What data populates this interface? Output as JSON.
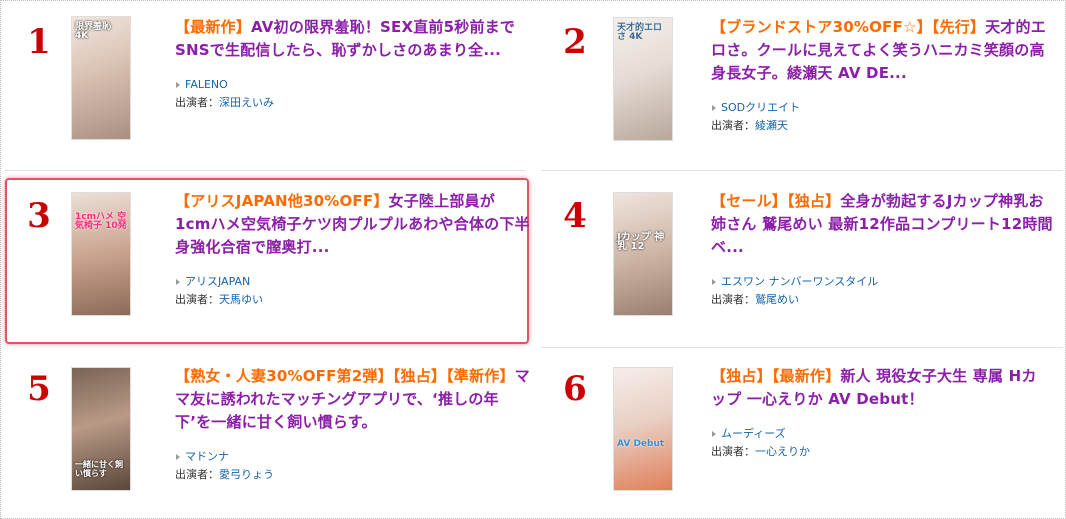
{
  "items": [
    {
      "rank": "1",
      "tags": [
        "【最新作】"
      ],
      "title": "AV初の限界羞恥！SEX直前5秒前までSNSで生配信したら、恥ずかしさのあまり全...",
      "maker": "FALENO",
      "actor_label": "出演者：",
      "actor": "深田えいみ",
      "thumb": {
        "caption": "限界羞恥 4K",
        "color": "#d9c1b2"
      }
    },
    {
      "rank": "2",
      "tags": [
        "【ブランドストア30%OFF☆】",
        "【先行】"
      ],
      "title": "天才的エロさ。クールに見えてよく笑うハニカミ笑顔の高身長女子。綾瀬天 AV DE...",
      "maker": "SODクリエイト",
      "actor_label": "出演者：",
      "actor": "綾瀬天",
      "thumb": {
        "caption": "天才的エロさ 4K",
        "color": "#e6dcd4"
      }
    },
    {
      "rank": "3",
      "tags": [
        "【アリスJAPAN他30%OFF】"
      ],
      "title": "女子陸上部員が1cmハメ空気椅子ケツ肉プルプルあわや合体の下半身強化合宿で膣奥打...",
      "maker": "アリスJAPAN",
      "actor_label": "出演者：",
      "actor": "天馬ゆい",
      "thumb": {
        "caption": "1cmハメ 空気椅子 10発",
        "color": "#c9a48f"
      }
    },
    {
      "rank": "4",
      "tags": [
        "【セール】",
        "【独占】"
      ],
      "title": "全身が勃起するJカップ神乳お姉さん 鷲尾めい 最新12作品コンプリート12時間ベ...",
      "maker": "エスワン ナンバーワンスタイル",
      "actor_label": "出演者：",
      "actor": "鷲尾めい",
      "thumb": {
        "caption": "Jカップ 神乳 12",
        "color": "#cfb7a8"
      }
    },
    {
      "rank": "5",
      "tags": [
        "【熟女・人妻30%OFF第2弾】",
        "【独占】",
        "【準新作】"
      ],
      "title": "ママ友に誘われたマッチングアプリで、‘推しの年下’を一緒に甘く飼い慣らす。",
      "maker": "マドンナ",
      "actor_label": "出演者：",
      "actor": "愛弓りょう",
      "thumb": {
        "caption": "一緒に甘く飼い慣らす",
        "color": "#b89a86"
      }
    },
    {
      "rank": "6",
      "tags": [
        "【独占】",
        "【最新作】"
      ],
      "title": "新人 現役女子大生 専属 Hカップ 一心えりか AV Debut！",
      "maker": "ムーディーズ",
      "actor_label": "出演者：",
      "actor": "一心えりか",
      "thumb": {
        "caption": "AV Debut",
        "color": "#e8cfc4"
      }
    }
  ]
}
